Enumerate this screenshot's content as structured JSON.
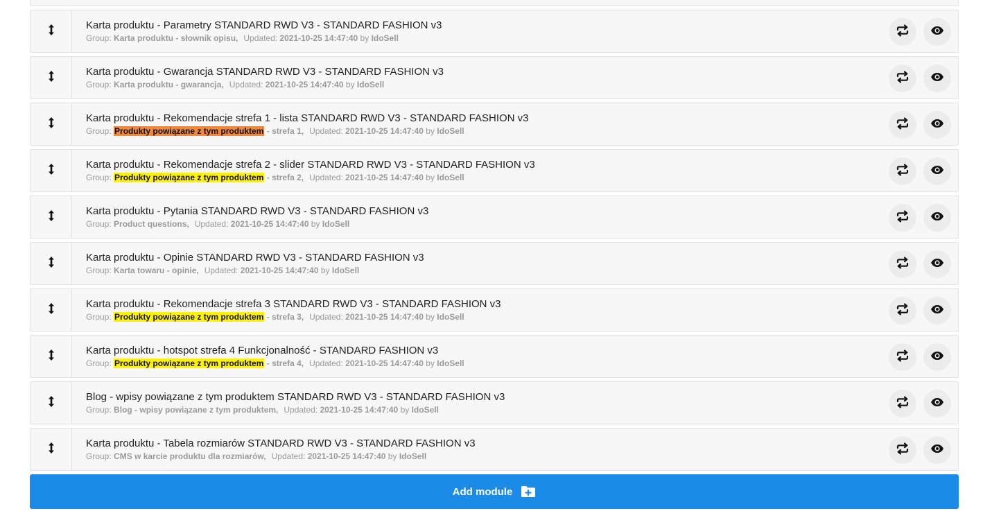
{
  "labels": {
    "group": "Group:",
    "updated": "Updated:",
    "by": "by"
  },
  "colors": {
    "accent": "#1a8be6",
    "highlight_orange": "#f0883e",
    "highlight_yellow": "#fff200"
  },
  "icons": {
    "drag": "updown-arrow-icon",
    "replace": "swap-arrows-icon",
    "preview": "eye-icon",
    "add": "folder-plus-icon"
  },
  "add_module_label": "Add module",
  "modules": [
    {
      "title": "Karta produktu - Parametry STANDARD RWD V3 - STANDARD FASHION v3",
      "group": "Karta produktu - słownik opisu,",
      "group_highlight": "",
      "group_suffix": "",
      "updated": "2021-10-25 14:47:40",
      "by": "IdoSell"
    },
    {
      "title": "Karta produktu - Gwarancja STANDARD RWD V3 - STANDARD FASHION v3",
      "group": "Karta produktu - gwarancja,",
      "group_highlight": "",
      "group_suffix": "",
      "updated": "2021-10-25 14:47:40",
      "by": "IdoSell"
    },
    {
      "title": "Karta produktu - Rekomendacje strefa 1 - lista STANDARD RWD V3 - STANDARD FASHION v3",
      "group": "",
      "group_highlight": "Produkty powiązane z tym produktem",
      "highlight_color": "orange",
      "group_suffix": " - strefa 1,",
      "updated": "2021-10-25 14:47:40",
      "by": "IdoSell"
    },
    {
      "title": "Karta produktu - Rekomendacje strefa 2 - slider STANDARD RWD V3 - STANDARD FASHION v3",
      "group": "",
      "group_highlight": "Produkty powiązane z tym produktem",
      "highlight_color": "yellow",
      "group_suffix": " - strefa 2,",
      "updated": "2021-10-25 14:47:40",
      "by": "IdoSell"
    },
    {
      "title": "Karta produktu - Pytania STANDARD RWD V3 - STANDARD FASHION v3",
      "group": "Product questions,",
      "group_highlight": "",
      "group_suffix": "",
      "updated": "2021-10-25 14:47:40",
      "by": "IdoSell"
    },
    {
      "title": "Karta produktu - Opinie STANDARD RWD V3 - STANDARD FASHION v3",
      "group": "Karta towaru - opinie,",
      "group_highlight": "",
      "group_suffix": "",
      "updated": "2021-10-25 14:47:40",
      "by": "IdoSell"
    },
    {
      "title": "Karta produktu - Rekomendacje strefa 3 STANDARD RWD V3 - STANDARD FASHION v3",
      "group": "",
      "group_highlight": "Produkty powiązane z tym produktem",
      "highlight_color": "yellow",
      "group_suffix": " - strefa 3,",
      "updated": "2021-10-25 14:47:40",
      "by": "IdoSell"
    },
    {
      "title": "Karta produktu - hotspot strefa 4 Funkcjonalność - STANDARD FASHION v3",
      "group": "",
      "group_highlight": "Produkty powiązane z tym produktem",
      "highlight_color": "yellow",
      "group_suffix": " - strefa 4,",
      "updated": "2021-10-25 14:47:40",
      "by": "IdoSell"
    },
    {
      "title": "Blog - wpisy powiązane z tym produktem STANDARD RWD V3 - STANDARD FASHION v3",
      "group": "Blog - wpisy powiązane z tym produktem,",
      "group_highlight": "",
      "group_suffix": "",
      "updated": "2021-10-25 14:47:40",
      "by": "IdoSell"
    },
    {
      "title": "Karta produktu - Tabela rozmiarów STANDARD RWD V3 - STANDARD FASHION v3",
      "group": "CMS w karcie produktu dla rozmiarów,",
      "group_highlight": "",
      "group_suffix": "",
      "updated": "2021-10-25 14:47:40",
      "by": "IdoSell"
    }
  ]
}
